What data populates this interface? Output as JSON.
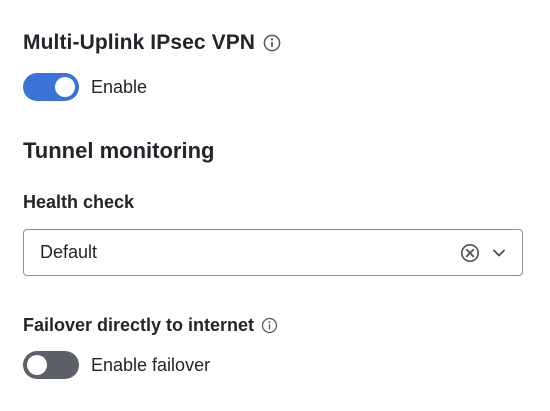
{
  "vpn": {
    "title": "Multi-Uplink IPsec VPN",
    "info_icon": "info-circle-icon",
    "toggle_label": "Enable",
    "enabled": true,
    "toggle_color_on": "#3b73d9"
  },
  "tunnel_monitoring": {
    "title": "Tunnel monitoring",
    "health_check": {
      "label": "Health check",
      "selected_value": "Default",
      "clear_icon": "clear-circle-icon",
      "dropdown_icon": "chevron-down-icon"
    },
    "failover": {
      "label": "Failover directly to internet",
      "info_icon": "info-circle-icon",
      "toggle_label": "Enable failover",
      "enabled": false,
      "toggle_color_off": "#5d6066"
    }
  }
}
